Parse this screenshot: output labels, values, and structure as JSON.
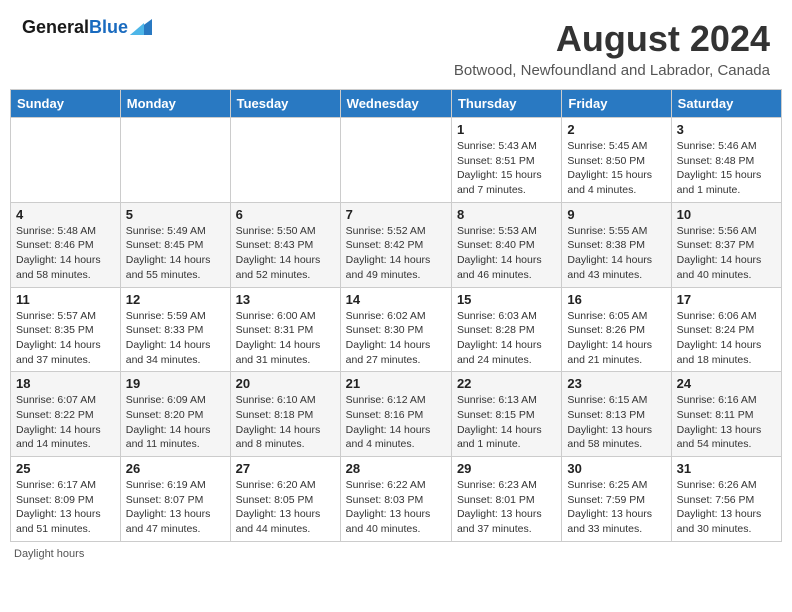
{
  "header": {
    "logo_general": "General",
    "logo_blue": "Blue",
    "main_title": "August 2024",
    "sub_title": "Botwood, Newfoundland and Labrador, Canada"
  },
  "days_of_week": [
    "Sunday",
    "Monday",
    "Tuesday",
    "Wednesday",
    "Thursday",
    "Friday",
    "Saturday"
  ],
  "weeks": [
    [
      {
        "day": "",
        "info": ""
      },
      {
        "day": "",
        "info": ""
      },
      {
        "day": "",
        "info": ""
      },
      {
        "day": "",
        "info": ""
      },
      {
        "day": "1",
        "info": "Sunrise: 5:43 AM\nSunset: 8:51 PM\nDaylight: 15 hours and 7 minutes."
      },
      {
        "day": "2",
        "info": "Sunrise: 5:45 AM\nSunset: 8:50 PM\nDaylight: 15 hours and 4 minutes."
      },
      {
        "day": "3",
        "info": "Sunrise: 5:46 AM\nSunset: 8:48 PM\nDaylight: 15 hours and 1 minute."
      }
    ],
    [
      {
        "day": "4",
        "info": "Sunrise: 5:48 AM\nSunset: 8:46 PM\nDaylight: 14 hours and 58 minutes."
      },
      {
        "day": "5",
        "info": "Sunrise: 5:49 AM\nSunset: 8:45 PM\nDaylight: 14 hours and 55 minutes."
      },
      {
        "day": "6",
        "info": "Sunrise: 5:50 AM\nSunset: 8:43 PM\nDaylight: 14 hours and 52 minutes."
      },
      {
        "day": "7",
        "info": "Sunrise: 5:52 AM\nSunset: 8:42 PM\nDaylight: 14 hours and 49 minutes."
      },
      {
        "day": "8",
        "info": "Sunrise: 5:53 AM\nSunset: 8:40 PM\nDaylight: 14 hours and 46 minutes."
      },
      {
        "day": "9",
        "info": "Sunrise: 5:55 AM\nSunset: 8:38 PM\nDaylight: 14 hours and 43 minutes."
      },
      {
        "day": "10",
        "info": "Sunrise: 5:56 AM\nSunset: 8:37 PM\nDaylight: 14 hours and 40 minutes."
      }
    ],
    [
      {
        "day": "11",
        "info": "Sunrise: 5:57 AM\nSunset: 8:35 PM\nDaylight: 14 hours and 37 minutes."
      },
      {
        "day": "12",
        "info": "Sunrise: 5:59 AM\nSunset: 8:33 PM\nDaylight: 14 hours and 34 minutes."
      },
      {
        "day": "13",
        "info": "Sunrise: 6:00 AM\nSunset: 8:31 PM\nDaylight: 14 hours and 31 minutes."
      },
      {
        "day": "14",
        "info": "Sunrise: 6:02 AM\nSunset: 8:30 PM\nDaylight: 14 hours and 27 minutes."
      },
      {
        "day": "15",
        "info": "Sunrise: 6:03 AM\nSunset: 8:28 PM\nDaylight: 14 hours and 24 minutes."
      },
      {
        "day": "16",
        "info": "Sunrise: 6:05 AM\nSunset: 8:26 PM\nDaylight: 14 hours and 21 minutes."
      },
      {
        "day": "17",
        "info": "Sunrise: 6:06 AM\nSunset: 8:24 PM\nDaylight: 14 hours and 18 minutes."
      }
    ],
    [
      {
        "day": "18",
        "info": "Sunrise: 6:07 AM\nSunset: 8:22 PM\nDaylight: 14 hours and 14 minutes."
      },
      {
        "day": "19",
        "info": "Sunrise: 6:09 AM\nSunset: 8:20 PM\nDaylight: 14 hours and 11 minutes."
      },
      {
        "day": "20",
        "info": "Sunrise: 6:10 AM\nSunset: 8:18 PM\nDaylight: 14 hours and 8 minutes."
      },
      {
        "day": "21",
        "info": "Sunrise: 6:12 AM\nSunset: 8:16 PM\nDaylight: 14 hours and 4 minutes."
      },
      {
        "day": "22",
        "info": "Sunrise: 6:13 AM\nSunset: 8:15 PM\nDaylight: 14 hours and 1 minute."
      },
      {
        "day": "23",
        "info": "Sunrise: 6:15 AM\nSunset: 8:13 PM\nDaylight: 13 hours and 58 minutes."
      },
      {
        "day": "24",
        "info": "Sunrise: 6:16 AM\nSunset: 8:11 PM\nDaylight: 13 hours and 54 minutes."
      }
    ],
    [
      {
        "day": "25",
        "info": "Sunrise: 6:17 AM\nSunset: 8:09 PM\nDaylight: 13 hours and 51 minutes."
      },
      {
        "day": "26",
        "info": "Sunrise: 6:19 AM\nSunset: 8:07 PM\nDaylight: 13 hours and 47 minutes."
      },
      {
        "day": "27",
        "info": "Sunrise: 6:20 AM\nSunset: 8:05 PM\nDaylight: 13 hours and 44 minutes."
      },
      {
        "day": "28",
        "info": "Sunrise: 6:22 AM\nSunset: 8:03 PM\nDaylight: 13 hours and 40 minutes."
      },
      {
        "day": "29",
        "info": "Sunrise: 6:23 AM\nSunset: 8:01 PM\nDaylight: 13 hours and 37 minutes."
      },
      {
        "day": "30",
        "info": "Sunrise: 6:25 AM\nSunset: 7:59 PM\nDaylight: 13 hours and 33 minutes."
      },
      {
        "day": "31",
        "info": "Sunrise: 6:26 AM\nSunset: 7:56 PM\nDaylight: 13 hours and 30 minutes."
      }
    ]
  ],
  "footer": "Daylight hours"
}
